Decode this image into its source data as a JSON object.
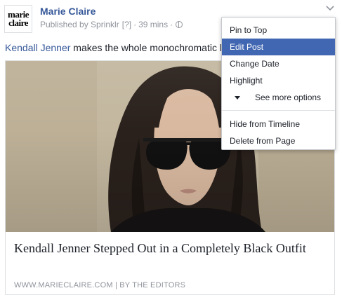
{
  "header": {
    "logo_line1": "marie",
    "logo_line2": "claire",
    "page_name": "Marie Claire",
    "published_by": "Published by Sprinklr",
    "info_tag": "[?]",
    "separator": "·",
    "time_ago": "39 mins",
    "separator2": "·"
  },
  "post": {
    "mention": "Kendall Jenner",
    "text": " makes the whole monochromatic look work"
  },
  "card": {
    "title": "Kendall Jenner Stepped Out in a Completely Black Outfit",
    "source": "WWW.MARIECLAIRE.COM | BY THE EDITORS"
  },
  "menu": {
    "items": [
      {
        "label": "Pin to Top"
      },
      {
        "label": "Edit Post"
      },
      {
        "label": "Change Date"
      },
      {
        "label": "Highlight"
      },
      {
        "label": "See more options"
      },
      {
        "label": "Hide from Timeline"
      },
      {
        "label": "Delete from Page"
      }
    ]
  },
  "colors": {
    "link": "#365899",
    "menu_highlight": "#4267b2",
    "meta_gray": "#90949c"
  },
  "icons": {
    "chevron": "chevron-down-icon",
    "globe": "globe-icon",
    "more_options": "triangle-down-icon"
  }
}
